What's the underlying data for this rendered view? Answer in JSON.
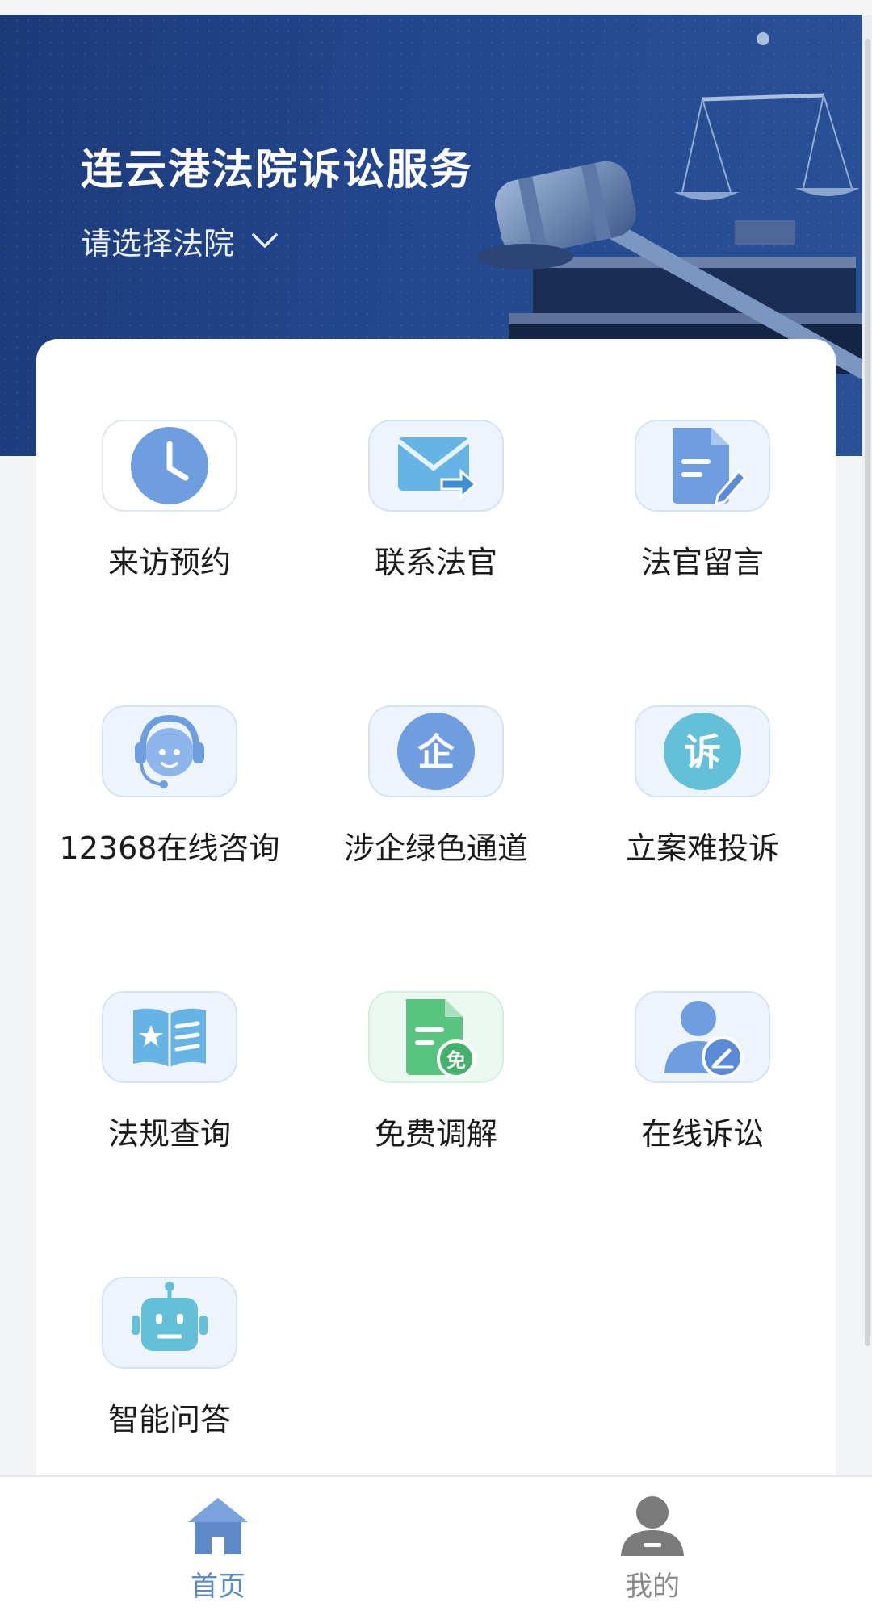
{
  "header": {
    "title": "连云港法院诉讼服务",
    "court_select": {
      "label": "请选择法院",
      "icon": "chevron-down-icon"
    }
  },
  "services": [
    {
      "label": "来访预约",
      "icon": "clock-icon"
    },
    {
      "label": "联系法官",
      "icon": "mail-send-icon"
    },
    {
      "label": "法官留言",
      "icon": "document-edit-icon"
    },
    {
      "label": "12368在线咨询",
      "icon": "headset-agent-icon"
    },
    {
      "label": "涉企绿色通道",
      "icon": "enterprise-icon",
      "glyph": "企"
    },
    {
      "label": "立案难投诉",
      "icon": "complaint-icon",
      "glyph": "诉"
    },
    {
      "label": "法规查询",
      "icon": "regulation-book-icon"
    },
    {
      "label": "免费调解",
      "icon": "free-mediation-icon",
      "glyph": "免"
    },
    {
      "label": "在线诉讼",
      "icon": "user-edit-icon"
    },
    {
      "label": "智能问答",
      "icon": "robot-icon"
    }
  ],
  "nav": {
    "home": {
      "label": "首页",
      "icon": "home-icon",
      "active": true
    },
    "me": {
      "label": "我的",
      "icon": "user-icon",
      "active": false
    }
  },
  "colors": {
    "header_bg": "#1f4285",
    "accent": "#5d88c9",
    "icon_blue": "#6f9ee0",
    "icon_teal": "#64c0d8",
    "icon_green": "#59c47f"
  }
}
